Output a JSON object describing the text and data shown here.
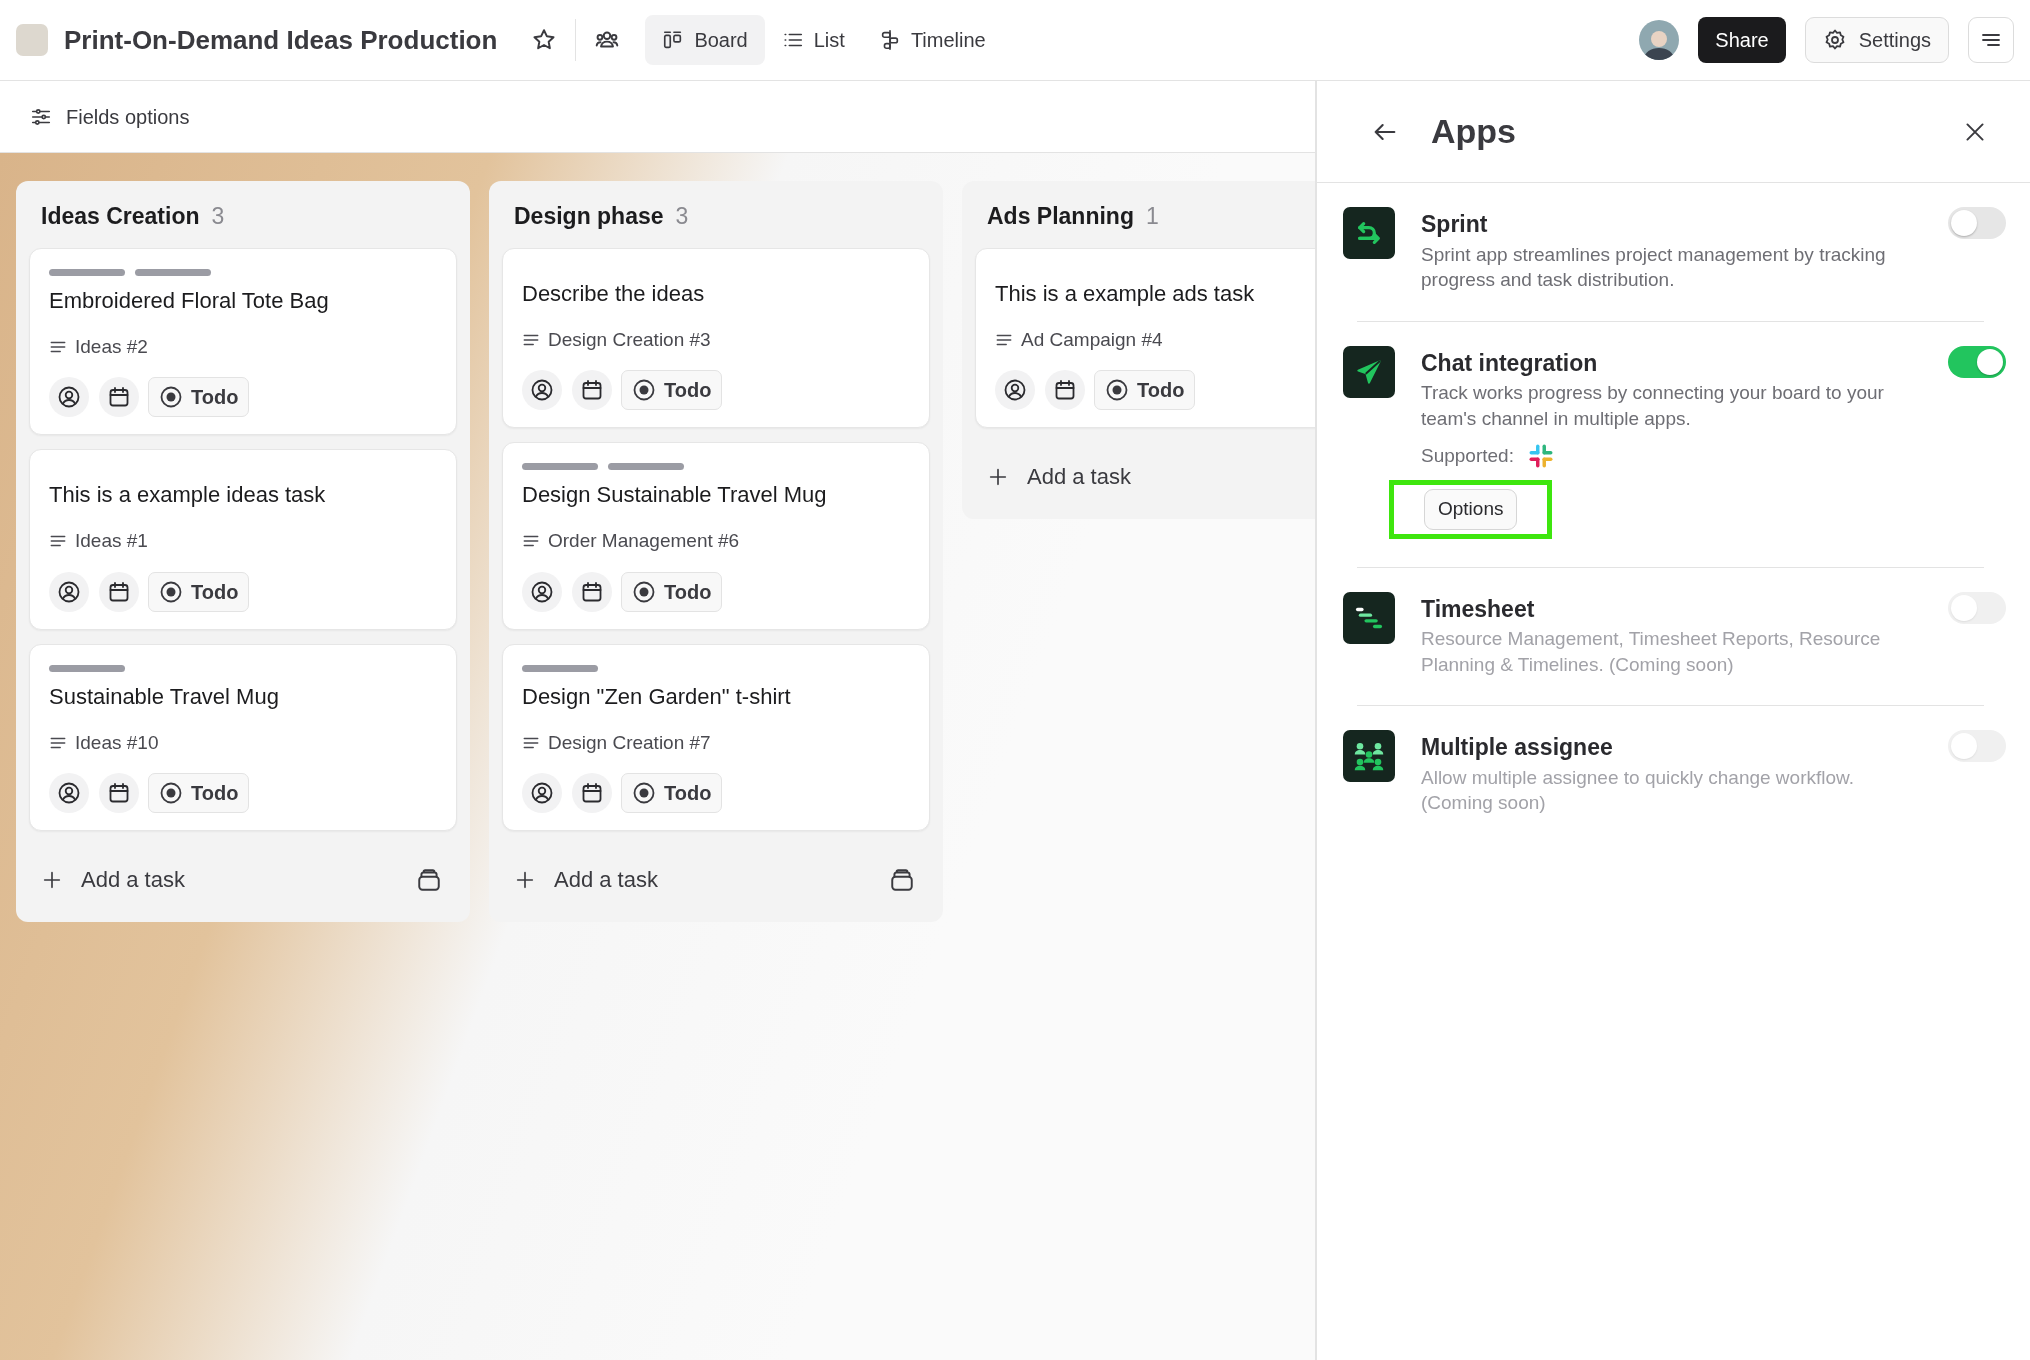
{
  "project": {
    "title": "Print-On-Demand Ideas Production"
  },
  "views": [
    {
      "label": "Board",
      "selected": true
    },
    {
      "label": "List",
      "selected": false
    },
    {
      "label": "Timeline",
      "selected": false
    }
  ],
  "header_actions": {
    "share": "Share",
    "settings": "Settings"
  },
  "toolbar": {
    "fields_options": "Fields options"
  },
  "columns": [
    {
      "title": "Ideas Creation",
      "count": "3",
      "add_task": "Add a task",
      "cards": [
        {
          "tags": [
            {
              "color": "#9b9ca4"
            },
            {
              "color": "#9b9ca4"
            }
          ],
          "title": "Embroidered Floral Tote Bag",
          "ref": "Ideas #2",
          "status": "Todo"
        },
        {
          "title": "This is a example ideas task",
          "ref": "Ideas #1",
          "status": "Todo"
        },
        {
          "tags": [
            {
              "color": "#9b9ca4"
            }
          ],
          "title": "Sustainable Travel Mug",
          "ref": "Ideas #10",
          "status": "Todo"
        }
      ]
    },
    {
      "title": "Design phase",
      "count": "3",
      "add_task": "Add a task",
      "cards": [
        {
          "title": "Describe the ideas",
          "ref": "Design Creation #3",
          "status": "Todo"
        },
        {
          "tags": [
            {
              "color": "#9b9ca4"
            },
            {
              "color": "#9b9ca4"
            }
          ],
          "title": "Design Sustainable Travel Mug",
          "ref": "Order Management #6",
          "status": "Todo"
        },
        {
          "tags": [
            {
              "color": "#9b9ca4"
            }
          ],
          "title": "Design \"Zen Garden\" t-shirt",
          "ref": "Design Creation #7",
          "status": "Todo"
        }
      ]
    },
    {
      "title": "Ads Planning",
      "count": "1",
      "add_task": "Add a task",
      "cards": [
        {
          "title": "This is a example ads task",
          "ref": "Ad Campaign #4",
          "status": "Todo"
        }
      ]
    }
  ],
  "panel": {
    "title": "Apps",
    "apps": [
      {
        "name": "Sprint",
        "description": "Sprint app streamlines project management by tracking progress and task distribution.",
        "on": false,
        "disabled": false
      },
      {
        "name": "Chat integration",
        "description": "Track works progress by connecting your board to your team's channel in multiple apps.",
        "on": true,
        "disabled": false,
        "supported": "Supported:",
        "options": {
          "label": "Options",
          "highlighted": true
        }
      },
      {
        "name": "Timesheet",
        "description": "Resource Management, Timesheet Reports, Resource Planning & Timelines. (Coming soon)",
        "on": false,
        "disabled": true
      },
      {
        "name": "Multiple assignee",
        "description": "Allow multiple assignee to quickly change workflow. (Coming soon)",
        "on": false,
        "disabled": true
      }
    ]
  }
}
